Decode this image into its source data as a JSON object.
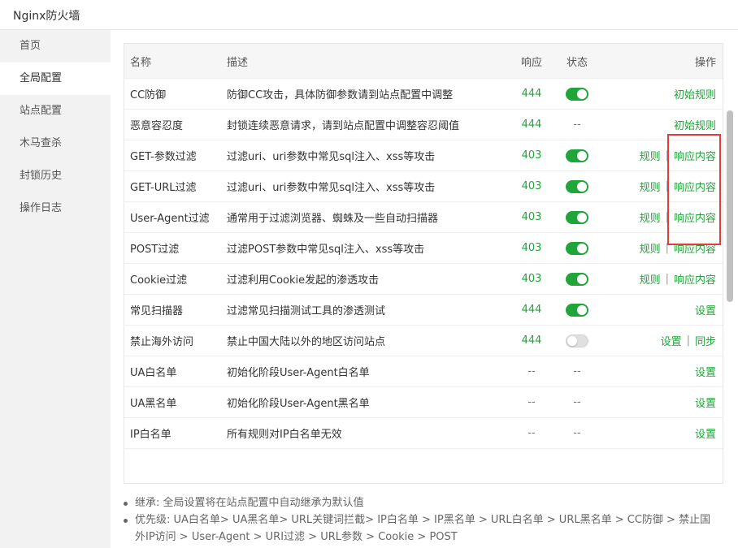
{
  "window": {
    "title": "Nginx防火墙"
  },
  "sidebar": {
    "items": [
      {
        "label": "首页"
      },
      {
        "label": "全局配置"
      },
      {
        "label": "站点配置"
      },
      {
        "label": "木马查杀"
      },
      {
        "label": "封锁历史"
      },
      {
        "label": "操作日志"
      }
    ],
    "active_index": 1
  },
  "table": {
    "headers": {
      "name": "名称",
      "desc": "描述",
      "resp": "响应",
      "status": "状态",
      "op": "操作"
    },
    "rows": [
      {
        "name": "CC防御",
        "desc": "防御CC攻击，具体防御参数请到站点配置中调整",
        "resp": "444",
        "status": "on",
        "ops": [
          "初始规则"
        ]
      },
      {
        "name": "恶意容忍度",
        "desc": "封锁连续恶意请求，请到站点配置中调整容忍阈值",
        "resp": "444",
        "status": "--",
        "ops": [
          "初始规则"
        ]
      },
      {
        "name": "GET-参数过滤",
        "desc": "过滤uri、uri参数中常见sql注入、xss等攻击",
        "resp": "403",
        "status": "on",
        "ops": [
          "规则",
          "响应内容"
        ]
      },
      {
        "name": "GET-URL过滤",
        "desc": "过滤uri、uri参数中常见sql注入、xss等攻击",
        "resp": "403",
        "status": "on",
        "ops": [
          "规则",
          "响应内容"
        ]
      },
      {
        "name": "User-Agent过滤",
        "desc": "通常用于过滤浏览器、蜘蛛及一些自动扫描器",
        "resp": "403",
        "status": "on",
        "ops": [
          "规则",
          "响应内容"
        ]
      },
      {
        "name": "POST过滤",
        "desc": "过滤POST参数中常见sql注入、xss等攻击",
        "resp": "403",
        "status": "on",
        "ops": [
          "规则",
          "响应内容"
        ]
      },
      {
        "name": "Cookie过滤",
        "desc": "过滤利用Cookie发起的渗透攻击",
        "resp": "403",
        "status": "on",
        "ops": [
          "规则",
          "响应内容"
        ]
      },
      {
        "name": "常见扫描器",
        "desc": "过滤常见扫描测试工具的渗透测试",
        "resp": "444",
        "status": "on",
        "ops": [
          "设置"
        ]
      },
      {
        "name": "禁止海外访问",
        "desc": "禁止中国大陆以外的地区访问站点",
        "resp": "444",
        "status": "off",
        "ops": [
          "设置",
          "同步"
        ]
      },
      {
        "name": "UA白名单",
        "desc": "初始化阶段User-Agent白名单",
        "resp": "--",
        "status": "--",
        "ops": [
          "设置"
        ]
      },
      {
        "name": "UA黑名单",
        "desc": "初始化阶段User-Agent黑名单",
        "resp": "--",
        "status": "--",
        "ops": [
          "设置"
        ]
      },
      {
        "name": "IP白名单",
        "desc": "所有规则对IP白名单无效",
        "resp": "--",
        "status": "--",
        "ops": [
          "设置"
        ]
      }
    ]
  },
  "notes": [
    "继承: 全局设置将在站点配置中自动继承为默认值",
    "优先级: UA白名单> UA黑名单> URL关键词拦截> IP白名单 > IP黑名单 > URL白名单 > URL黑名单 > CC防御 > 禁止国外IP访问 > User-Agent > URI过滤 > URL参数 > Cookie > POST"
  ],
  "colors": {
    "accent": "#20a53a",
    "highlight_border": "#e03c3c",
    "sidebar_bg": "#f2f2f2"
  }
}
